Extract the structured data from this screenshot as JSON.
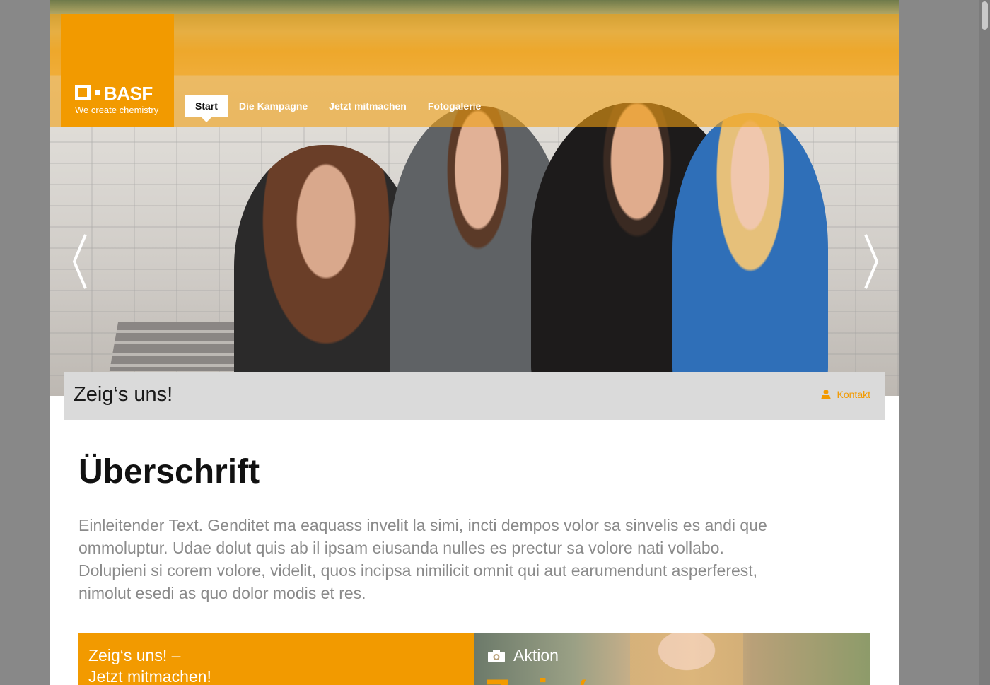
{
  "brand": {
    "name": "BASF",
    "tagline": "We create chemistry",
    "color": "#f29a00"
  },
  "nav": {
    "items": [
      {
        "label": "Start",
        "active": true
      },
      {
        "label": "Die Kampagne",
        "active": false
      },
      {
        "label": "Jetzt mitmachen",
        "active": false
      },
      {
        "label": "Fotogalerie",
        "active": false
      }
    ]
  },
  "hero": {
    "prev_icon": "chevron-left-icon",
    "next_icon": "chevron-right-icon"
  },
  "titlebar": {
    "title": "Zeig‘s uns!",
    "contact_label": "Kontakt",
    "contact_icon": "user-icon"
  },
  "content": {
    "headline": "Überschrift",
    "intro": "Einleitender Text. Genditet ma eaquass invelit la simi, incti dempos volor sa sinvelis es andi que ommoluptur. Udae dolut quis ab il ipsam eiusanda nulles es prectur sa volore nati vollabo. Dolupieni si corem volore, videlit, quos incipsa nimilicit omnit qui aut earumendunt asperferest, nimolut esedi as quo dolor modis et res."
  },
  "teasers": {
    "left": {
      "line1": "Zeig‘s uns! –",
      "line2": "Jetzt mitmachen!"
    },
    "right": {
      "label": "Aktion",
      "icon": "camera-icon",
      "big_text": "Zeig‘"
    }
  }
}
